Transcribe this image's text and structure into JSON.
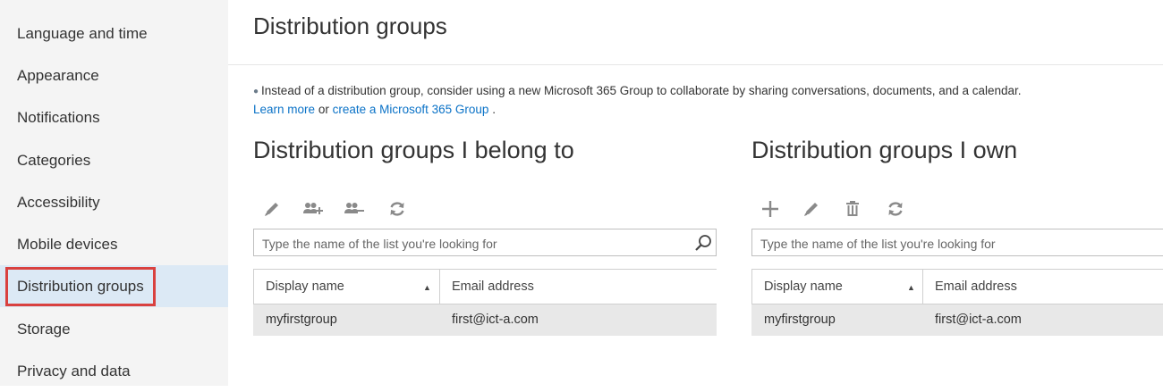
{
  "sidebar": {
    "items": [
      {
        "label": "Language and time"
      },
      {
        "label": "Appearance"
      },
      {
        "label": "Notifications"
      },
      {
        "label": "Categories"
      },
      {
        "label": "Accessibility"
      },
      {
        "label": "Mobile devices"
      },
      {
        "label": "Distribution groups",
        "selected": true
      },
      {
        "label": "Storage"
      },
      {
        "label": "Privacy and data"
      }
    ]
  },
  "main": {
    "title": "Distribution groups",
    "info": {
      "text": "Instead of a distribution group, consider using a new Microsoft 365 Group to collaborate by sharing conversations, documents, and a calendar.",
      "learn_more": "Learn more",
      "or": "or",
      "create_link": "create a Microsoft 365 Group",
      "period": "."
    },
    "belong": {
      "title": "Distribution groups I belong to",
      "search_placeholder": "Type the name of the list you're looking for",
      "columns": [
        "Display name",
        "Email address"
      ],
      "rows": [
        {
          "display_name": "myfirstgroup",
          "email": "first@ict-a.com"
        }
      ]
    },
    "own": {
      "title": "Distribution groups I own",
      "search_placeholder": "Type the name of the list you're looking for",
      "columns": [
        "Display name",
        "Email address"
      ],
      "rows": [
        {
          "display_name": "myfirstgroup",
          "email": "first@ict-a.com"
        }
      ]
    }
  },
  "icons": {
    "edit": "pencil-icon",
    "join": "join-group-icon",
    "leave": "leave-group-icon",
    "refresh": "refresh-icon",
    "add": "plus-icon",
    "delete": "trash-icon",
    "search": "search-icon",
    "sort": "sort-ascending-icon"
  },
  "colors": {
    "sidebar_bg": "#f4f4f4",
    "selected_bg": "#dce9f5",
    "highlight_border": "#d9413f",
    "link": "#0a72c7",
    "row_bg": "#e8e8e8"
  }
}
